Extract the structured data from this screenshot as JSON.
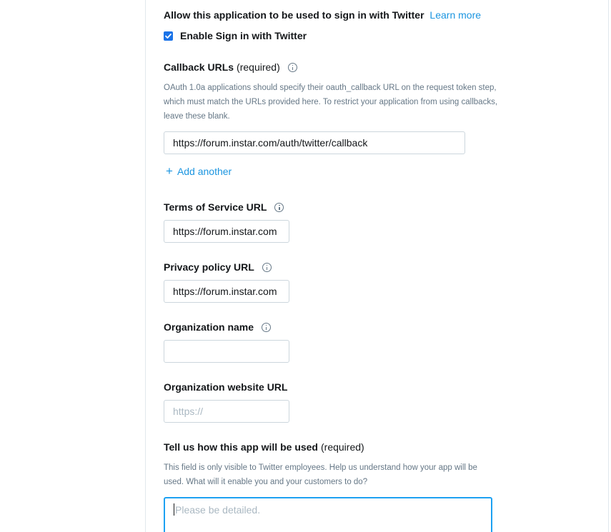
{
  "signin": {
    "title": "Allow this application to be used to sign in with Twitter",
    "learn_more": "Learn more",
    "checkbox_label": "Enable Sign in with Twitter",
    "checkbox_checked": true
  },
  "callback": {
    "label": "Callback URLs",
    "required": "(required)",
    "help": "OAuth 1.0a applications should specify their oauth_callback URL on the request token step, which must match the URLs provided here. To restrict your application from using callbacks, leave these blank.",
    "value": "https://forum.instar.com/auth/twitter/callback",
    "add_another": "Add another"
  },
  "terms": {
    "label": "Terms of Service URL",
    "value": "https://forum.instar.com"
  },
  "privacy": {
    "label": "Privacy policy URL",
    "value": "https://forum.instar.com"
  },
  "org_name": {
    "label": "Organization name",
    "value": ""
  },
  "org_website": {
    "label": "Organization website URL",
    "placeholder": "https://"
  },
  "usage": {
    "label": "Tell us how this app will be used",
    "required": "(required)",
    "help": "This field is only visible to Twitter employees. Help us understand how your app will be used. What will it enable you and your customers to do?",
    "placeholder": "Please be detailed."
  },
  "colors": {
    "link": "#1b95e0",
    "checkbox": "#1a73e8",
    "focus_border": "#1da1f2"
  },
  "icons": [
    "checkmark-icon",
    "info-icon",
    "plus-icon"
  ]
}
